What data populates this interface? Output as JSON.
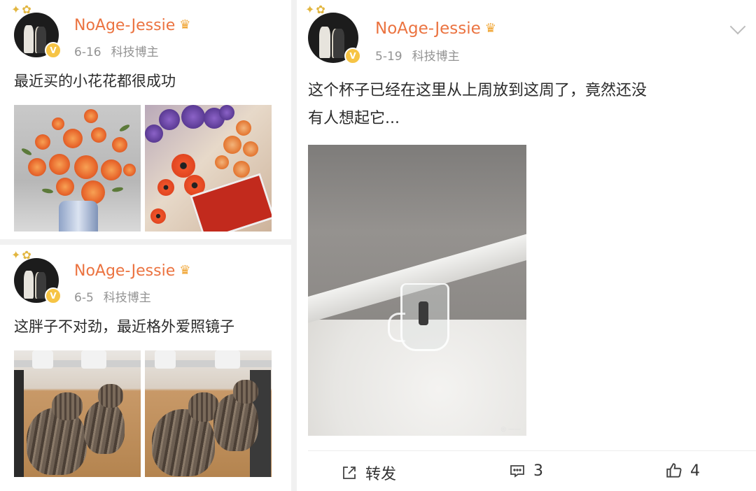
{
  "posts_left": [
    {
      "user": "NoAge-Jessie",
      "date": "6-16",
      "tag": "科技博主",
      "text": "最近买的小花花都很成功"
    },
    {
      "user": "NoAge-Jessie",
      "date": "6-5",
      "tag": "科技博主",
      "text": "这胖子不对劲，最近格外爱照镜子"
    }
  ],
  "post_right": {
    "user": "NoAge-Jessie",
    "date": "5-19",
    "tag": "科技博主",
    "text_line1": "这个杯子已经在这里从上周放到这周了，竟然还没",
    "text_line2": "有人想起它...",
    "actions": {
      "repost_label": "转发",
      "comment_count": "3",
      "like_count": "4"
    }
  },
  "icons": {
    "verified": "v-badge-icon",
    "crown": "crown-icon",
    "more": "chevron-down-icon",
    "repost": "repost-icon",
    "comment": "comment-icon",
    "like": "thumbs-up-icon"
  },
  "colors": {
    "username": "#eb7340",
    "meta": "#939393",
    "verified_badge": "#f6c445"
  }
}
